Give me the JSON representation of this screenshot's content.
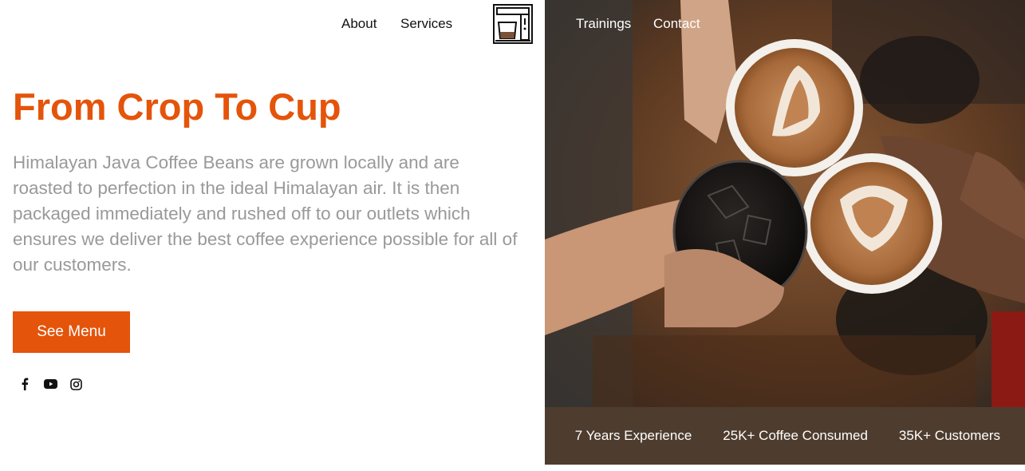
{
  "nav": {
    "items": [
      {
        "label": "About"
      },
      {
        "label": "Services"
      },
      {
        "label": "Trainings"
      },
      {
        "label": "Contact"
      }
    ],
    "logo_icon": "coffee-machine-icon"
  },
  "hero": {
    "title": "From Crop To Cup",
    "description": "Himalayan Java Coffee Beans are grown locally and are roasted to perfection in the ideal Himalayan air. It is then packaged immediately and rushed off to our outlets which ensures we deliver the best coffee experience possible for all of our customers.",
    "cta_label": "See Menu"
  },
  "socials": [
    {
      "icon": "facebook-icon"
    },
    {
      "icon": "youtube-icon"
    },
    {
      "icon": "instagram-icon"
    }
  ],
  "stats": [
    {
      "label": "7 Years Experience"
    },
    {
      "label": "25K+ Coffee Consumed"
    },
    {
      "label": "35K+ Customers"
    }
  ],
  "colors": {
    "accent": "#e4540a",
    "stats_bar": "#4e3d2f",
    "body_text": "#999999"
  }
}
